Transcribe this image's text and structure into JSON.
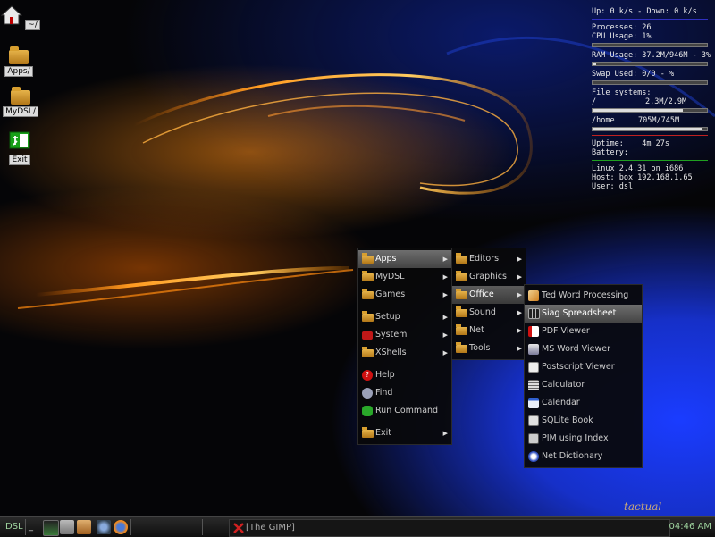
{
  "desktop": {
    "icons": [
      {
        "label": "~/",
        "icon": "home-icon"
      },
      {
        "label": "Apps/",
        "icon": "folder-icon"
      },
      {
        "label": "MyDSL/",
        "icon": "folder-icon"
      },
      {
        "label": "Exit",
        "icon": "exit-icon"
      }
    ],
    "signature": "tactual"
  },
  "conky": {
    "net": "Up: 0 k/s - Down: 0 k/s",
    "processes": "Processes: 26",
    "cpu": "CPU Usage: 1%",
    "cpu_pct": 1,
    "ram": "RAM Usage: 37.2M/946M - 3%",
    "ram_pct": 3,
    "swap": "Swap Used: 0/0 - %",
    "swap_pct": 0,
    "fs_header": "File systems:",
    "fs_root_label": "/",
    "fs_root_value": "2.3M/2.9M",
    "fs_root_pct": 79,
    "fs_home_label": "/home",
    "fs_home_value": "705M/745M",
    "fs_home_pct": 95,
    "uptime": "Uptime:    4m 27s",
    "battery": "Battery:",
    "kernel": "Linux 2.4.31 on i686",
    "host": "Host: box 192.168.1.65",
    "user": "User: dsl",
    "colors": {
      "net_rule": "#3030c0",
      "uptime_rule": "#c02020",
      "battery_rule": "#20a020"
    }
  },
  "menu_main": [
    {
      "label": "Apps",
      "icon": "folder-icon",
      "submenu": true
    },
    {
      "label": "MyDSL",
      "icon": "folder-icon",
      "submenu": true
    },
    {
      "label": "Games",
      "icon": "folder-icon",
      "submenu": true
    },
    {
      "label": "Setup",
      "icon": "folder-icon",
      "submenu": true
    },
    {
      "label": "System",
      "icon": "system-icon",
      "submenu": true
    },
    {
      "label": "XShells",
      "icon": "folder-icon",
      "submenu": true
    },
    {
      "label": "Help",
      "icon": "help-icon",
      "submenu": false
    },
    {
      "label": "Find",
      "icon": "find-icon",
      "submenu": false
    },
    {
      "label": "Run Command",
      "icon": "run-icon",
      "submenu": false
    },
    {
      "label": "Exit",
      "icon": "folder-icon",
      "submenu": true
    }
  ],
  "menu_apps": [
    {
      "label": "Editors"
    },
    {
      "label": "Graphics"
    },
    {
      "label": "Office"
    },
    {
      "label": "Sound"
    },
    {
      "label": "Net"
    },
    {
      "label": "Tools"
    }
  ],
  "menu_office": [
    {
      "label": "Ted Word Processing",
      "icon": "ted-icon"
    },
    {
      "label": "Siag Spreadsheet",
      "icon": "spreadsheet-icon"
    },
    {
      "label": "PDF Viewer",
      "icon": "pdf-icon"
    },
    {
      "label": "MS Word Viewer",
      "icon": "word-viewer-icon"
    },
    {
      "label": "Postscript Viewer",
      "icon": "postscript-icon"
    },
    {
      "label": "Calculator",
      "icon": "calculator-icon"
    },
    {
      "label": "Calendar",
      "icon": "calendar-icon"
    },
    {
      "label": "SQLite Book",
      "icon": "sqlite-icon"
    },
    {
      "label": "PIM using Index",
      "icon": "pim-icon"
    },
    {
      "label": "Net Dictionary",
      "icon": "dictionary-icon"
    }
  ],
  "taskbar": {
    "start_label": "DSL",
    "task_label": "[The GIMP]",
    "clock": "04:46 AM"
  }
}
